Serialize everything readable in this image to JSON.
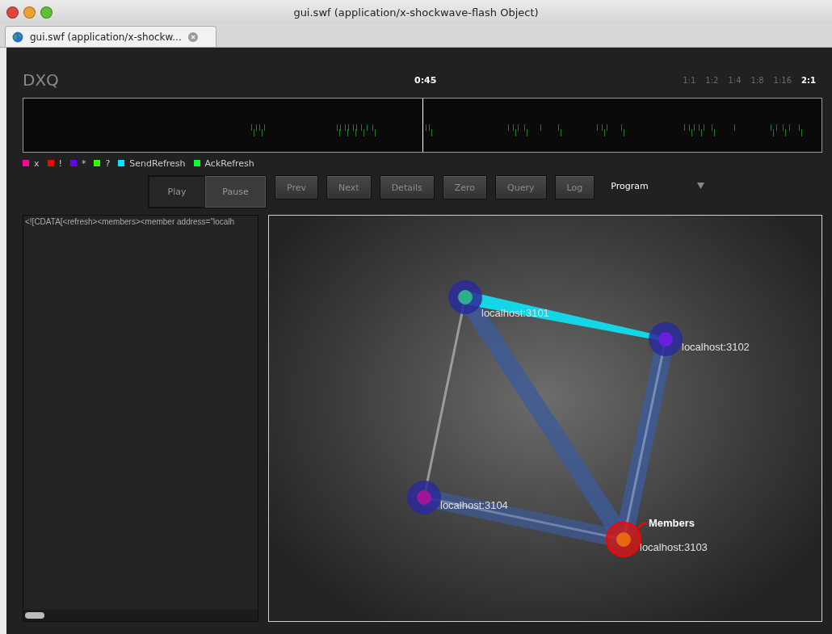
{
  "window": {
    "title": "gui.swf (application/x-shockwave-flash Object)"
  },
  "tabs": [
    {
      "label": "gui.swf (application/x-shockw...",
      "selected": true
    }
  ],
  "app": {
    "title": "DXQ",
    "time": "0:45",
    "zoom_levels": [
      {
        "label": "1:1",
        "selected": false
      },
      {
        "label": "1:2",
        "selected": false
      },
      {
        "label": "1:4",
        "selected": false
      },
      {
        "label": "1:8",
        "selected": false
      },
      {
        "label": "1:16",
        "selected": false
      },
      {
        "label": "2:1",
        "selected": true
      }
    ]
  },
  "legend": [
    {
      "label": "x",
      "color": "#ff0099"
    },
    {
      "label": "!",
      "color": "#ff0000"
    },
    {
      "label": "*",
      "color": "#6600ff"
    },
    {
      "label": "?",
      "color": "#33ff00"
    },
    {
      "label": "SendRefresh",
      "color": "#00e5ff"
    },
    {
      "label": "AckRefresh",
      "color": "#00ff33"
    }
  ],
  "transport": [
    {
      "label": "Play",
      "selected": false
    },
    {
      "label": "Pause",
      "selected": true
    }
  ],
  "buttons": [
    "Prev",
    "Next",
    "Details",
    "Zero",
    "Query",
    "Log"
  ],
  "program_select": {
    "value": "Program"
  },
  "log_text": "<![CDATA[<refresh><members><member address=\"localh",
  "graph": {
    "nodes": [
      {
        "label": "localhost:3101",
        "color": "#2fae8a",
        "selected": false
      },
      {
        "label": "localhost:3102",
        "color": "#6a1ee0",
        "selected": false
      },
      {
        "label": "localhost:3104",
        "color": "#a0169a",
        "selected": false
      },
      {
        "label": "localhost:3103",
        "color": "#e86a10",
        "selected": true,
        "callout": "Members"
      }
    ]
  }
}
